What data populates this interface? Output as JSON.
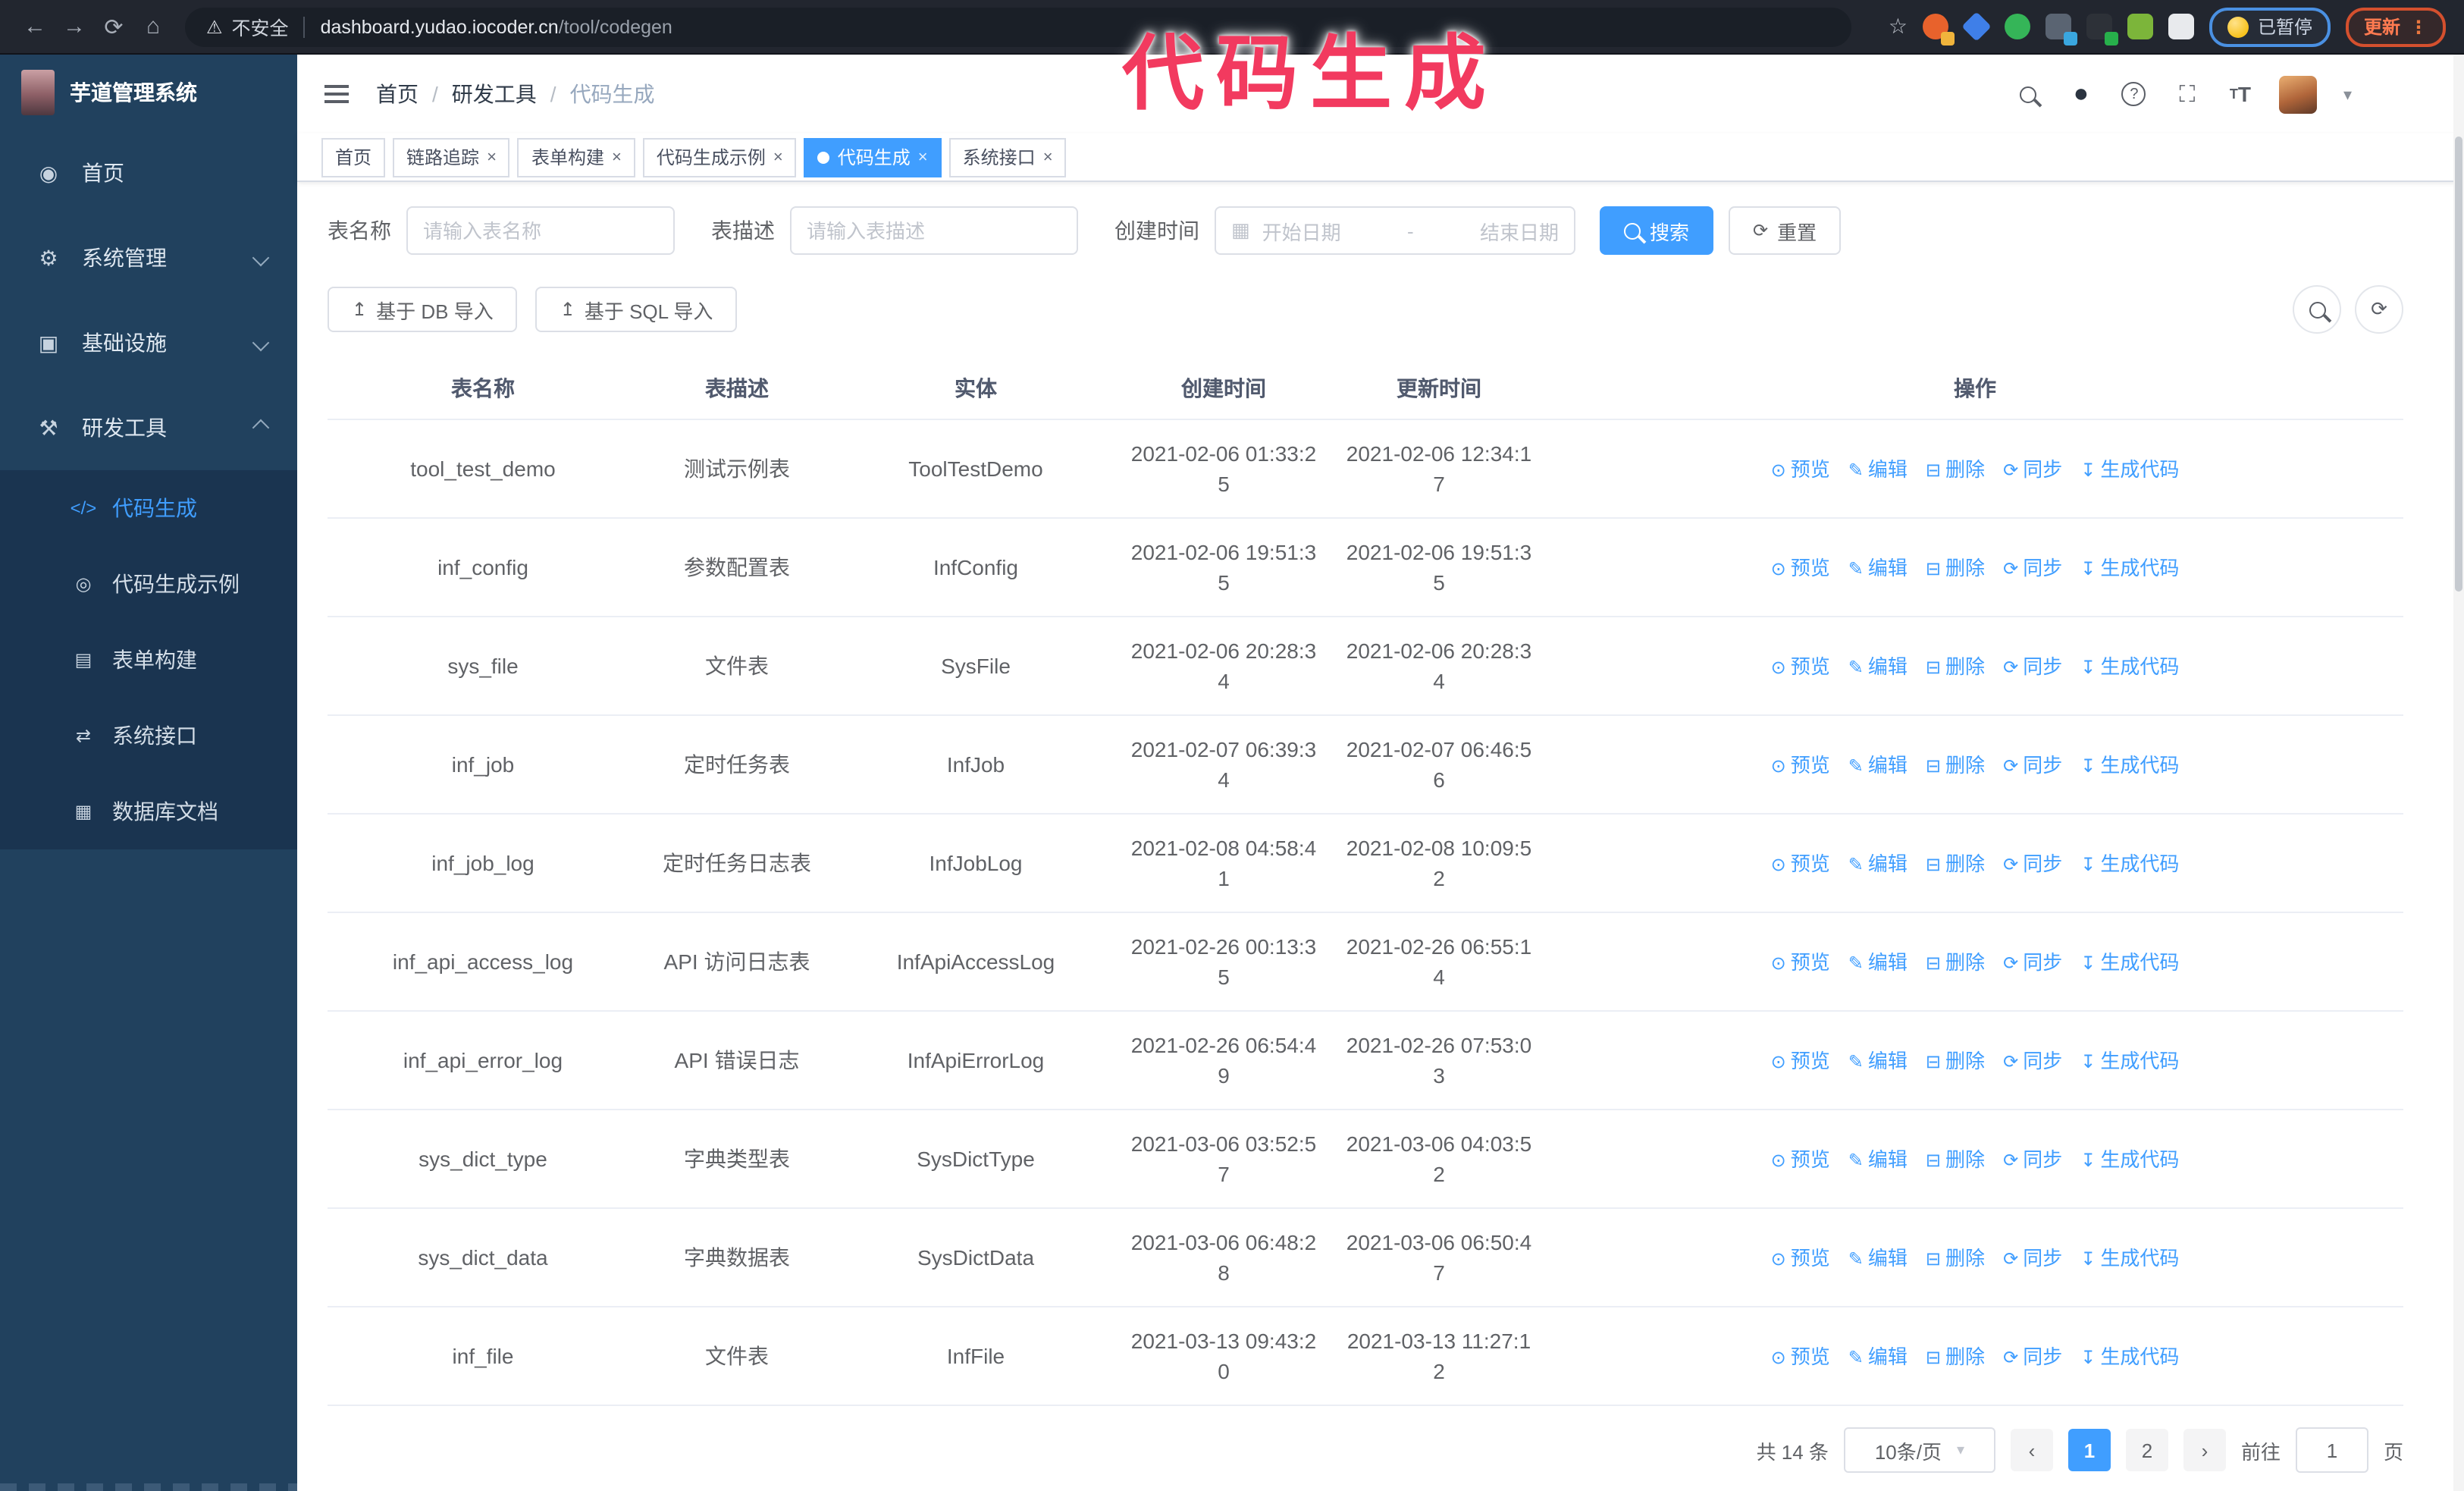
{
  "browser": {
    "security_warning": "不安全",
    "url_host": "dashboard.yudao.iocoder.cn",
    "url_path": "/tool/codegen",
    "paused_badge": "已暂停",
    "update_button": "更新",
    "extensions": [
      {
        "name": "extension-orange-c-icon",
        "color": "#e8622c",
        "shape": "circle",
        "badge": "#f0b43c"
      },
      {
        "name": "extension-blue-gem-icon",
        "color": "#3f7fe8",
        "shape": "diamond"
      },
      {
        "name": "extension-green-check-icon",
        "color": "#35b558",
        "shape": "circle"
      },
      {
        "name": "extension-grid-icon",
        "color": "#5a6472",
        "shape": "square",
        "badge": "#3aa7e0"
      },
      {
        "name": "extension-dark-on-icon",
        "color": "#2d3138",
        "shape": "square",
        "badge": "#27b04b"
      },
      {
        "name": "extension-green-key-icon",
        "color": "#7cb53a",
        "shape": "square"
      },
      {
        "name": "extension-puzzle-icon",
        "color": "#e8eaed",
        "shape": "square"
      }
    ]
  },
  "annotation": "代码生成",
  "sidebar": {
    "title": "芋道管理系统",
    "items": [
      {
        "id": "home",
        "label": "首页",
        "icon": "dashboard-icon",
        "chevron": null,
        "expanded": false
      },
      {
        "id": "system",
        "label": "系统管理",
        "icon": "gear-icon",
        "chevron": "down",
        "expanded": false
      },
      {
        "id": "infra",
        "label": "基础设施",
        "icon": "monitor-icon",
        "chevron": "down",
        "expanded": false
      },
      {
        "id": "devtools",
        "label": "研发工具",
        "icon": "toolbox-icon",
        "chevron": "up",
        "expanded": true
      }
    ],
    "submenu": [
      {
        "id": "codegen",
        "label": "代码生成",
        "icon": "code-icon",
        "active": true
      },
      {
        "id": "codegen-example",
        "label": "代码生成示例",
        "icon": "example-icon",
        "active": false
      },
      {
        "id": "form-builder",
        "label": "表单构建",
        "icon": "form-icon",
        "active": false
      },
      {
        "id": "system-api",
        "label": "系统接口",
        "icon": "api-icon",
        "active": false
      },
      {
        "id": "db-doc",
        "label": "数据库文档",
        "icon": "db-doc-icon",
        "active": false
      }
    ]
  },
  "breadcrumb": [
    "首页",
    "研发工具",
    "代码生成"
  ],
  "tags": [
    {
      "label": "首页",
      "closable": false,
      "active": false
    },
    {
      "label": "链路追踪",
      "closable": true,
      "active": false
    },
    {
      "label": "表单构建",
      "closable": true,
      "active": false
    },
    {
      "label": "代码生成示例",
      "closable": true,
      "active": false
    },
    {
      "label": "代码生成",
      "closable": true,
      "active": true
    },
    {
      "label": "系统接口",
      "closable": true,
      "active": false
    }
  ],
  "search_form": {
    "table_name_label": "表名称",
    "table_name_placeholder": "请输入表名称",
    "table_desc_label": "表描述",
    "table_desc_placeholder": "请输入表描述",
    "create_time_label": "创建时间",
    "start_date_placeholder": "开始日期",
    "range_separator": "-",
    "end_date_placeholder": "结束日期",
    "search_label": "搜索",
    "reset_label": "重置"
  },
  "toolbar": {
    "import_db_label": "基于 DB 导入",
    "import_sql_label": "基于 SQL 导入"
  },
  "table": {
    "columns": [
      "表名称",
      "表描述",
      "实体",
      "创建时间",
      "更新时间",
      "操作"
    ],
    "actions": [
      "预览",
      "编辑",
      "删除",
      "同步",
      "生成代码"
    ],
    "rows": [
      [
        "tool_test_demo",
        "测试示例表",
        "ToolTestDemo",
        "2021-02-06 01:33:25",
        "2021-02-06 12:34:17"
      ],
      [
        "inf_config",
        "参数配置表",
        "InfConfig",
        "2021-02-06 19:51:35",
        "2021-02-06 19:51:35"
      ],
      [
        "sys_file",
        "文件表",
        "SysFile",
        "2021-02-06 20:28:34",
        "2021-02-06 20:28:34"
      ],
      [
        "inf_job",
        "定时任务表",
        "InfJob",
        "2021-02-07 06:39:34",
        "2021-02-07 06:46:56"
      ],
      [
        "inf_job_log",
        "定时任务日志表",
        "InfJobLog",
        "2021-02-08 04:58:41",
        "2021-02-08 10:09:52"
      ],
      [
        "inf_api_access_log",
        "API 访问日志表",
        "InfApiAccessLog",
        "2021-02-26 00:13:35",
        "2021-02-26 06:55:14"
      ],
      [
        "inf_api_error_log",
        "API 错误日志",
        "InfApiErrorLog",
        "2021-02-26 06:54:49",
        "2021-02-26 07:53:03"
      ],
      [
        "sys_dict_type",
        "字典类型表",
        "SysDictType",
        "2021-03-06 03:52:57",
        "2021-03-06 04:03:52"
      ],
      [
        "sys_dict_data",
        "字典数据表",
        "SysDictData",
        "2021-03-06 06:48:28",
        "2021-03-06 06:50:47"
      ],
      [
        "inf_file",
        "文件表",
        "InfFile",
        "2021-03-13 09:43:20",
        "2021-03-13 11:27:12"
      ]
    ]
  },
  "pagination": {
    "total_label": "共 14 条",
    "page_size_label": "10条/页",
    "pages": [
      "1",
      "2"
    ],
    "active_page": "1",
    "goto_label": "前往",
    "goto_value": "1",
    "goto_suffix": "页"
  },
  "colors": {
    "primary": "#409eff",
    "sidebar-bg": "#21415e",
    "submenu-bg": "#1a3450",
    "chrome-bg": "#22262f",
    "urlbar-bg": "#1a1f27",
    "annotation": "#f23a5f",
    "update-accent": "#ff7a50",
    "paused-accent": "#4a90e2"
  }
}
